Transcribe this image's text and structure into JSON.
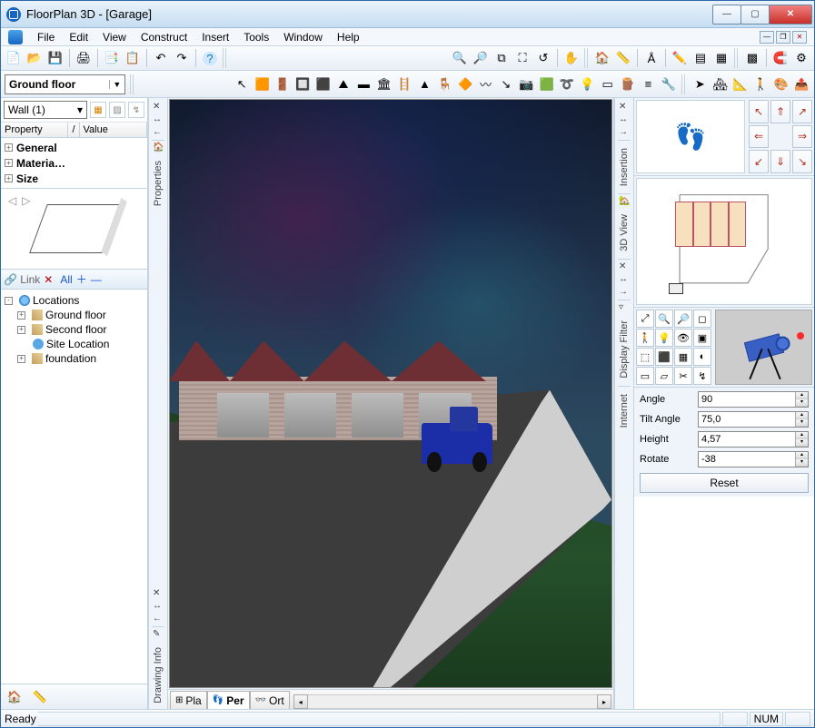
{
  "window": {
    "title": "FloorPlan 3D - [Garage]"
  },
  "menu": {
    "file": "File",
    "edit": "Edit",
    "view": "View",
    "construct": "Construct",
    "insert": "Insert",
    "tools": "Tools",
    "window": "Window",
    "help": "Help"
  },
  "floor_select": "Ground floor",
  "props": {
    "selected": "Wall (1)",
    "col_property": "Property",
    "col_value": "Value",
    "groups": [
      "General",
      "Materia…",
      "Size"
    ]
  },
  "sidetabs": {
    "properties": "Properties",
    "drawing": "Drawing Info",
    "view3d": "3D View",
    "insertion": "Insertion",
    "filter": "Display Filter",
    "internet": "Internet"
  },
  "locations": {
    "toolbar": {
      "link": "Link",
      "all": "All"
    },
    "root": "Locations",
    "nodes": [
      {
        "label": "Ground floor",
        "icon": "floor"
      },
      {
        "label": "Second floor",
        "icon": "floor"
      },
      {
        "label": "Site Location",
        "icon": "site"
      },
      {
        "label": "foundation",
        "icon": "floor"
      }
    ]
  },
  "view_tabs": {
    "plan": "Pla",
    "perspective": "Per",
    "ortho": "Ort"
  },
  "camera": {
    "angle_label": "Angle",
    "angle": "90",
    "tilt_label": "Tilt Angle",
    "tilt": "75,0",
    "height_label": "Height",
    "height": "4,57",
    "rotate_label": "Rotate",
    "rotate": "-38",
    "reset": "Reset"
  },
  "status": {
    "ready": "Ready",
    "num": "NUM"
  }
}
